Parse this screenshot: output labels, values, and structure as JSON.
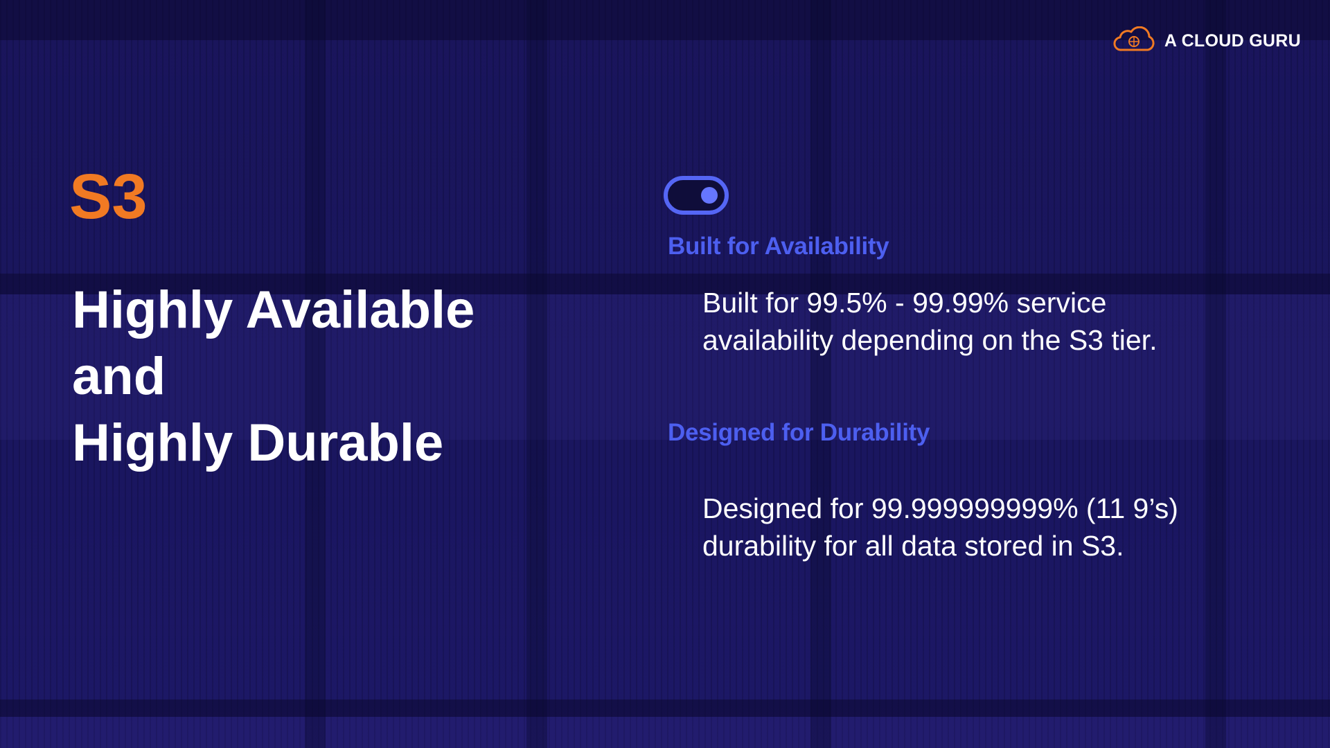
{
  "brand": {
    "logo_icon": "cloud-icon",
    "name": "A CLOUD GURU",
    "accent_color": "#f17a23"
  },
  "slide": {
    "topic": "S3",
    "headline": {
      "line1": "Highly Available",
      "line2": "and",
      "line3": "Highly Durable"
    },
    "toggle_icon": "toggle-switch-icon",
    "sections": [
      {
        "heading": "Built for Availability",
        "body_line1": "Built for 99.5% - 99.99% service",
        "body_line2": "availability depending on the S3 tier."
      },
      {
        "heading": "Designed for Durability",
        "body_line1": "Designed for 99.999999999% (11 9’s)",
        "body_line2": "durability for all data stored in S3."
      }
    ],
    "heading_color": "#4d5ff0",
    "background_color": "#1b1763"
  }
}
